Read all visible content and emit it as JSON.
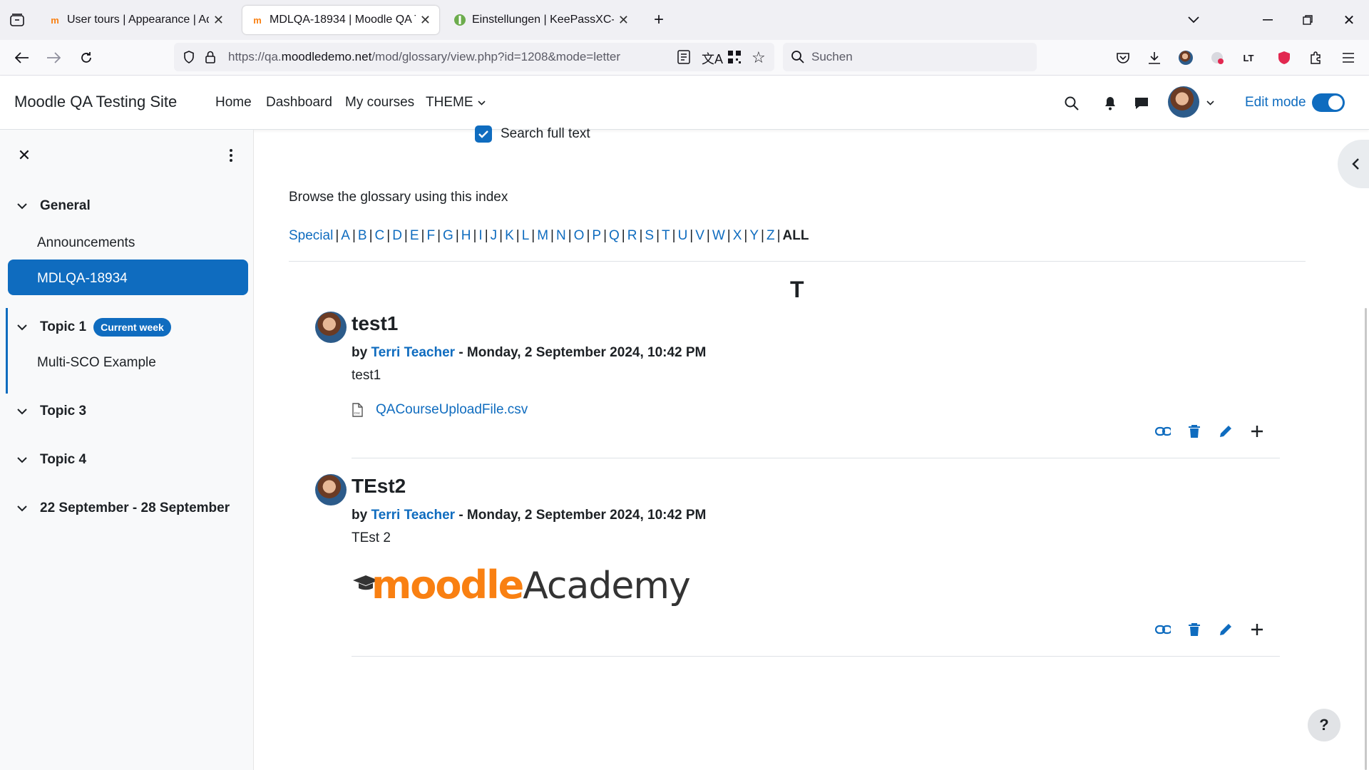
{
  "browser": {
    "tabs": [
      {
        "title": "User tours | Appearance | Admi",
        "active": false
      },
      {
        "title": "MDLQA-18934 | Moodle QA Te",
        "active": true
      },
      {
        "title": "Einstellungen | KeePassXC-Brow",
        "active": false
      }
    ],
    "url_prefix": "https://qa.",
    "url_host": "moodledemo.net",
    "url_path": "/mod/glossary/view.php?id=1208&mode=letter",
    "search_placeholder": "Suchen"
  },
  "header": {
    "site_name": "Moodle QA Testing Site",
    "nav": [
      "Home",
      "Dashboard",
      "My courses",
      "THEME"
    ],
    "edit_mode_label": "Edit mode",
    "edit_mode_on": true
  },
  "drawer": {
    "sections": [
      {
        "label": "General",
        "items": [
          "Announcements",
          "MDLQA-18934"
        ]
      },
      {
        "label": "Topic 1",
        "badge": "Current week",
        "items": [
          "Multi-SCO Example"
        ]
      },
      {
        "label": "Topic 3",
        "items": []
      },
      {
        "label": "Topic 4",
        "items": []
      },
      {
        "label": "22 September - 28 September",
        "items": []
      }
    ],
    "active_item": "MDLQA-18934"
  },
  "main": {
    "search_full_text_label": "Search full text",
    "search_full_text_checked": true,
    "browse_label": "Browse the glossary using this index",
    "index_letters": [
      "Special",
      "A",
      "B",
      "C",
      "D",
      "E",
      "F",
      "G",
      "H",
      "I",
      "J",
      "K",
      "L",
      "M",
      "N",
      "O",
      "P",
      "Q",
      "R",
      "S",
      "T",
      "U",
      "V",
      "W",
      "X",
      "Y",
      "Z"
    ],
    "index_current": "ALL",
    "letter_heading": "T",
    "entries": [
      {
        "title": "test1",
        "by": "by",
        "author": "Terri Teacher",
        "date": " - Monday, 2 September 2024, 10:42 PM",
        "text": "test1",
        "attachment": "QACourseUploadFile.csv"
      },
      {
        "title": "TEst2",
        "by": "by",
        "author": "Terri Teacher",
        "date": " - Monday, 2 September 2024, 10:42 PM",
        "text": "TEst 2",
        "image_text_moodle": "moodle",
        "image_text_academy": "Academy"
      }
    ]
  },
  "colors": {
    "brand": "#0f6cbf",
    "moodle_orange": "#f98012",
    "text": "#1d2125"
  }
}
